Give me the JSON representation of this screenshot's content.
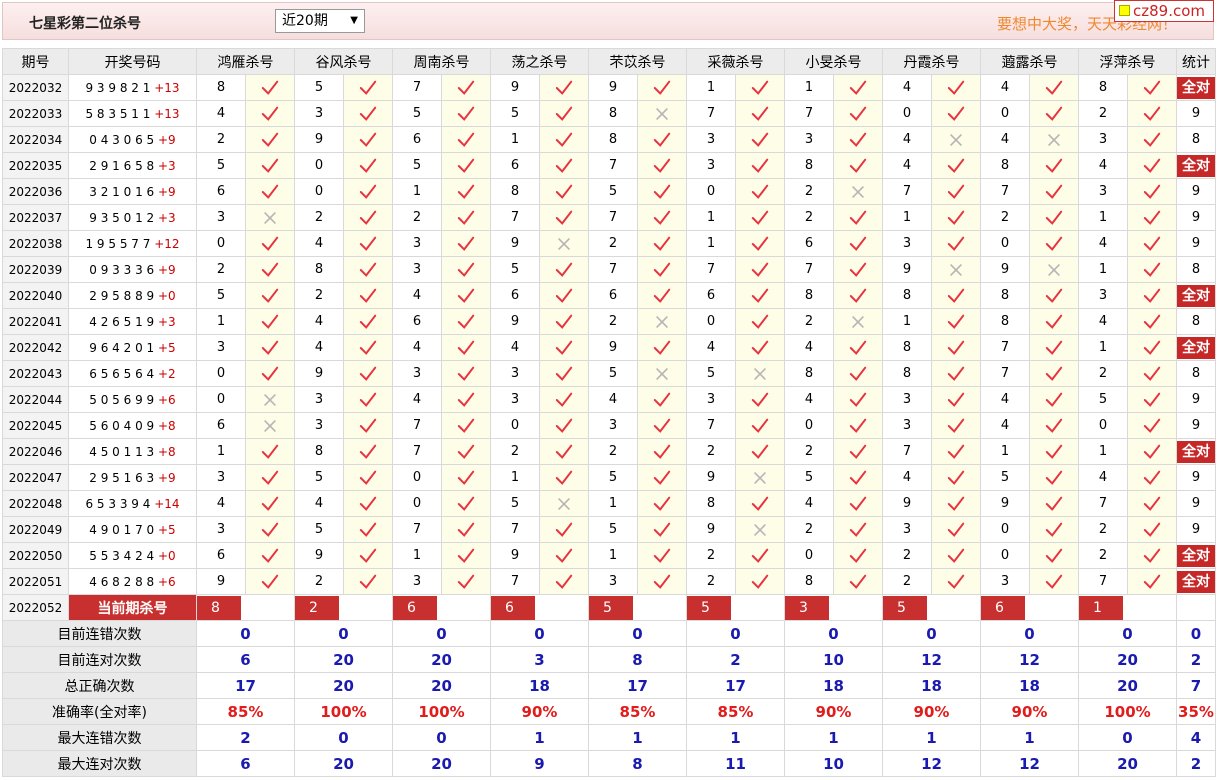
{
  "header": {
    "title": "七星彩第二位杀号",
    "period_select": "近20期",
    "slogan": "要想中大奖，天天彩经网！",
    "site_badge": "cz89.com"
  },
  "columns": {
    "issue": "期号",
    "draw": "开奖号码",
    "experts": [
      "鸿雁杀号",
      "谷风杀号",
      "周南杀号",
      "荡之杀号",
      "芣苡杀号",
      "采薇杀号",
      "小旻杀号",
      "丹霞杀号",
      "蕸露杀号",
      "浮萍杀号"
    ],
    "stat": "统计"
  },
  "all_correct_label": "全对",
  "rows": [
    {
      "issue": "2022032",
      "draw": "9 3 9 8 2 1",
      "sum": "+13",
      "kills": [
        [
          8,
          1
        ],
        [
          5,
          1
        ],
        [
          7,
          1
        ],
        [
          9,
          1
        ],
        [
          9,
          1
        ],
        [
          1,
          1
        ],
        [
          1,
          1
        ],
        [
          4,
          1
        ],
        [
          4,
          1
        ],
        [
          8,
          1
        ]
      ],
      "stat": "全对"
    },
    {
      "issue": "2022033",
      "draw": "5 8 3 5 1 1",
      "sum": "+13",
      "kills": [
        [
          4,
          1
        ],
        [
          3,
          1
        ],
        [
          5,
          1
        ],
        [
          5,
          1
        ],
        [
          8,
          0
        ],
        [
          7,
          1
        ],
        [
          7,
          1
        ],
        [
          0,
          1
        ],
        [
          0,
          1
        ],
        [
          2,
          1
        ]
      ],
      "stat": "9"
    },
    {
      "issue": "2022034",
      "draw": "0 4 3 0 6 5",
      "sum": "+9",
      "kills": [
        [
          2,
          1
        ],
        [
          9,
          1
        ],
        [
          6,
          1
        ],
        [
          1,
          1
        ],
        [
          8,
          1
        ],
        [
          3,
          1
        ],
        [
          3,
          1
        ],
        [
          4,
          0
        ],
        [
          4,
          0
        ],
        [
          3,
          1
        ]
      ],
      "stat": "8"
    },
    {
      "issue": "2022035",
      "draw": "2 9 1 6 5 8",
      "sum": "+3",
      "kills": [
        [
          5,
          1
        ],
        [
          0,
          1
        ],
        [
          5,
          1
        ],
        [
          6,
          1
        ],
        [
          7,
          1
        ],
        [
          3,
          1
        ],
        [
          8,
          1
        ],
        [
          4,
          1
        ],
        [
          8,
          1
        ],
        [
          4,
          1
        ]
      ],
      "stat": "全对"
    },
    {
      "issue": "2022036",
      "draw": "3 2 1 0 1 6",
      "sum": "+9",
      "kills": [
        [
          6,
          1
        ],
        [
          0,
          1
        ],
        [
          1,
          1
        ],
        [
          8,
          1
        ],
        [
          5,
          1
        ],
        [
          0,
          1
        ],
        [
          2,
          0
        ],
        [
          7,
          1
        ],
        [
          7,
          1
        ],
        [
          3,
          1
        ]
      ],
      "stat": "9"
    },
    {
      "issue": "2022037",
      "draw": "9 3 5 0 1 2",
      "sum": "+3",
      "kills": [
        [
          3,
          0
        ],
        [
          2,
          1
        ],
        [
          2,
          1
        ],
        [
          7,
          1
        ],
        [
          7,
          1
        ],
        [
          1,
          1
        ],
        [
          2,
          1
        ],
        [
          1,
          1
        ],
        [
          2,
          1
        ],
        [
          1,
          1
        ]
      ],
      "stat": "9"
    },
    {
      "issue": "2022038",
      "draw": "1 9 5 5 7 7",
      "sum": "+12",
      "kills": [
        [
          0,
          1
        ],
        [
          4,
          1
        ],
        [
          3,
          1
        ],
        [
          9,
          0
        ],
        [
          2,
          1
        ],
        [
          1,
          1
        ],
        [
          6,
          1
        ],
        [
          3,
          1
        ],
        [
          0,
          1
        ],
        [
          4,
          1
        ]
      ],
      "stat": "9"
    },
    {
      "issue": "2022039",
      "draw": "0 9 3 3 3 6",
      "sum": "+9",
      "kills": [
        [
          2,
          1
        ],
        [
          8,
          1
        ],
        [
          3,
          1
        ],
        [
          5,
          1
        ],
        [
          7,
          1
        ],
        [
          7,
          1
        ],
        [
          7,
          1
        ],
        [
          9,
          0
        ],
        [
          9,
          0
        ],
        [
          1,
          1
        ]
      ],
      "stat": "8"
    },
    {
      "issue": "2022040",
      "draw": "2 9 5 8 8 9",
      "sum": "+0",
      "kills": [
        [
          5,
          1
        ],
        [
          2,
          1
        ],
        [
          4,
          1
        ],
        [
          6,
          1
        ],
        [
          6,
          1
        ],
        [
          6,
          1
        ],
        [
          8,
          1
        ],
        [
          8,
          1
        ],
        [
          8,
          1
        ],
        [
          3,
          1
        ]
      ],
      "stat": "全对"
    },
    {
      "issue": "2022041",
      "draw": "4 2 6 5 1 9",
      "sum": "+3",
      "kills": [
        [
          1,
          1
        ],
        [
          4,
          1
        ],
        [
          6,
          1
        ],
        [
          9,
          1
        ],
        [
          2,
          0
        ],
        [
          0,
          1
        ],
        [
          2,
          0
        ],
        [
          1,
          1
        ],
        [
          8,
          1
        ],
        [
          4,
          1
        ]
      ],
      "stat": "8"
    },
    {
      "issue": "2022042",
      "draw": "9 6 4 2 0 1",
      "sum": "+5",
      "kills": [
        [
          3,
          1
        ],
        [
          4,
          1
        ],
        [
          4,
          1
        ],
        [
          4,
          1
        ],
        [
          9,
          1
        ],
        [
          4,
          1
        ],
        [
          4,
          1
        ],
        [
          8,
          1
        ],
        [
          7,
          1
        ],
        [
          1,
          1
        ]
      ],
      "stat": "全对"
    },
    {
      "issue": "2022043",
      "draw": "6 5 6 5 6 4",
      "sum": "+2",
      "kills": [
        [
          0,
          1
        ],
        [
          9,
          1
        ],
        [
          3,
          1
        ],
        [
          3,
          1
        ],
        [
          5,
          0
        ],
        [
          5,
          0
        ],
        [
          8,
          1
        ],
        [
          8,
          1
        ],
        [
          7,
          1
        ],
        [
          2,
          1
        ]
      ],
      "stat": "8"
    },
    {
      "issue": "2022044",
      "draw": "5 0 5 6 9 9",
      "sum": "+6",
      "kills": [
        [
          0,
          0
        ],
        [
          3,
          1
        ],
        [
          4,
          1
        ],
        [
          3,
          1
        ],
        [
          4,
          1
        ],
        [
          3,
          1
        ],
        [
          4,
          1
        ],
        [
          3,
          1
        ],
        [
          4,
          1
        ],
        [
          5,
          1
        ]
      ],
      "stat": "9"
    },
    {
      "issue": "2022045",
      "draw": "5 6 0 4 0 9",
      "sum": "+8",
      "kills": [
        [
          6,
          0
        ],
        [
          3,
          1
        ],
        [
          7,
          1
        ],
        [
          0,
          1
        ],
        [
          3,
          1
        ],
        [
          7,
          1
        ],
        [
          0,
          1
        ],
        [
          3,
          1
        ],
        [
          4,
          1
        ],
        [
          0,
          1
        ]
      ],
      "stat": "9"
    },
    {
      "issue": "2022046",
      "draw": "4 5 0 1 1 3",
      "sum": "+8",
      "kills": [
        [
          1,
          1
        ],
        [
          8,
          1
        ],
        [
          7,
          1
        ],
        [
          2,
          1
        ],
        [
          2,
          1
        ],
        [
          2,
          1
        ],
        [
          2,
          1
        ],
        [
          7,
          1
        ],
        [
          1,
          1
        ],
        [
          1,
          1
        ]
      ],
      "stat": "全对"
    },
    {
      "issue": "2022047",
      "draw": "2 9 5 1 6 3",
      "sum": "+9",
      "kills": [
        [
          3,
          1
        ],
        [
          5,
          1
        ],
        [
          0,
          1
        ],
        [
          1,
          1
        ],
        [
          5,
          1
        ],
        [
          9,
          0
        ],
        [
          5,
          1
        ],
        [
          4,
          1
        ],
        [
          5,
          1
        ],
        [
          4,
          1
        ]
      ],
      "stat": "9"
    },
    {
      "issue": "2022048",
      "draw": "6 5 3 3 9 4",
      "sum": "+14",
      "kills": [
        [
          4,
          1
        ],
        [
          4,
          1
        ],
        [
          0,
          1
        ],
        [
          5,
          0
        ],
        [
          1,
          1
        ],
        [
          8,
          1
        ],
        [
          4,
          1
        ],
        [
          9,
          1
        ],
        [
          9,
          1
        ],
        [
          7,
          1
        ]
      ],
      "stat": "9"
    },
    {
      "issue": "2022049",
      "draw": "4 9 0 1 7 0",
      "sum": "+5",
      "kills": [
        [
          3,
          1
        ],
        [
          5,
          1
        ],
        [
          7,
          1
        ],
        [
          7,
          1
        ],
        [
          5,
          1
        ],
        [
          9,
          0
        ],
        [
          2,
          1
        ],
        [
          3,
          1
        ],
        [
          0,
          1
        ],
        [
          2,
          1
        ]
      ],
      "stat": "9"
    },
    {
      "issue": "2022050",
      "draw": "5 5 3 4 2 4",
      "sum": "+0",
      "kills": [
        [
          6,
          1
        ],
        [
          9,
          1
        ],
        [
          1,
          1
        ],
        [
          9,
          1
        ],
        [
          1,
          1
        ],
        [
          2,
          1
        ],
        [
          0,
          1
        ],
        [
          2,
          1
        ],
        [
          0,
          1
        ],
        [
          2,
          1
        ]
      ],
      "stat": "全对"
    },
    {
      "issue": "2022051",
      "draw": "4 6 8 2 8 8",
      "sum": "+6",
      "kills": [
        [
          9,
          1
        ],
        [
          2,
          1
        ],
        [
          3,
          1
        ],
        [
          7,
          1
        ],
        [
          3,
          1
        ],
        [
          2,
          1
        ],
        [
          8,
          1
        ],
        [
          2,
          1
        ],
        [
          3,
          1
        ],
        [
          7,
          1
        ]
      ],
      "stat": "全对"
    }
  ],
  "current": {
    "issue": "2022052",
    "label": "当前期杀号",
    "kills": [
      "8",
      "2",
      "6",
      "6",
      "5",
      "5",
      "3",
      "5",
      "6",
      "1"
    ]
  },
  "summary": [
    {
      "label": "目前连错次数",
      "values": [
        "0",
        "0",
        "0",
        "0",
        "0",
        "0",
        "0",
        "0",
        "0",
        "0"
      ],
      "stat": "0",
      "color": "blue"
    },
    {
      "label": "目前连对次数",
      "values": [
        "6",
        "20",
        "20",
        "3",
        "8",
        "2",
        "10",
        "12",
        "12",
        "20"
      ],
      "stat": "2",
      "color": "blue"
    },
    {
      "label": "总正确次数",
      "values": [
        "17",
        "20",
        "20",
        "18",
        "17",
        "17",
        "18",
        "18",
        "18",
        "20"
      ],
      "stat": "7",
      "color": "blue"
    },
    {
      "label": "准确率(全对率)",
      "values": [
        "85%",
        "100%",
        "100%",
        "90%",
        "85%",
        "85%",
        "90%",
        "90%",
        "90%",
        "100%"
      ],
      "stat": "35%",
      "color": "red"
    },
    {
      "label": "最大连错次数",
      "values": [
        "2",
        "0",
        "0",
        "1",
        "1",
        "1",
        "1",
        "1",
        "1",
        "0"
      ],
      "stat": "4",
      "color": "blue"
    },
    {
      "label": "最大连对次数",
      "values": [
        "6",
        "20",
        "20",
        "9",
        "8",
        "11",
        "10",
        "12",
        "12",
        "20"
      ],
      "stat": "2",
      "color": "blue"
    }
  ],
  "colors": {
    "check": "#e8333f",
    "cross": "#b5b5b5",
    "accent_red": "#c83030",
    "value_blue": "#1a1ab0",
    "slogan": "#f08830"
  }
}
